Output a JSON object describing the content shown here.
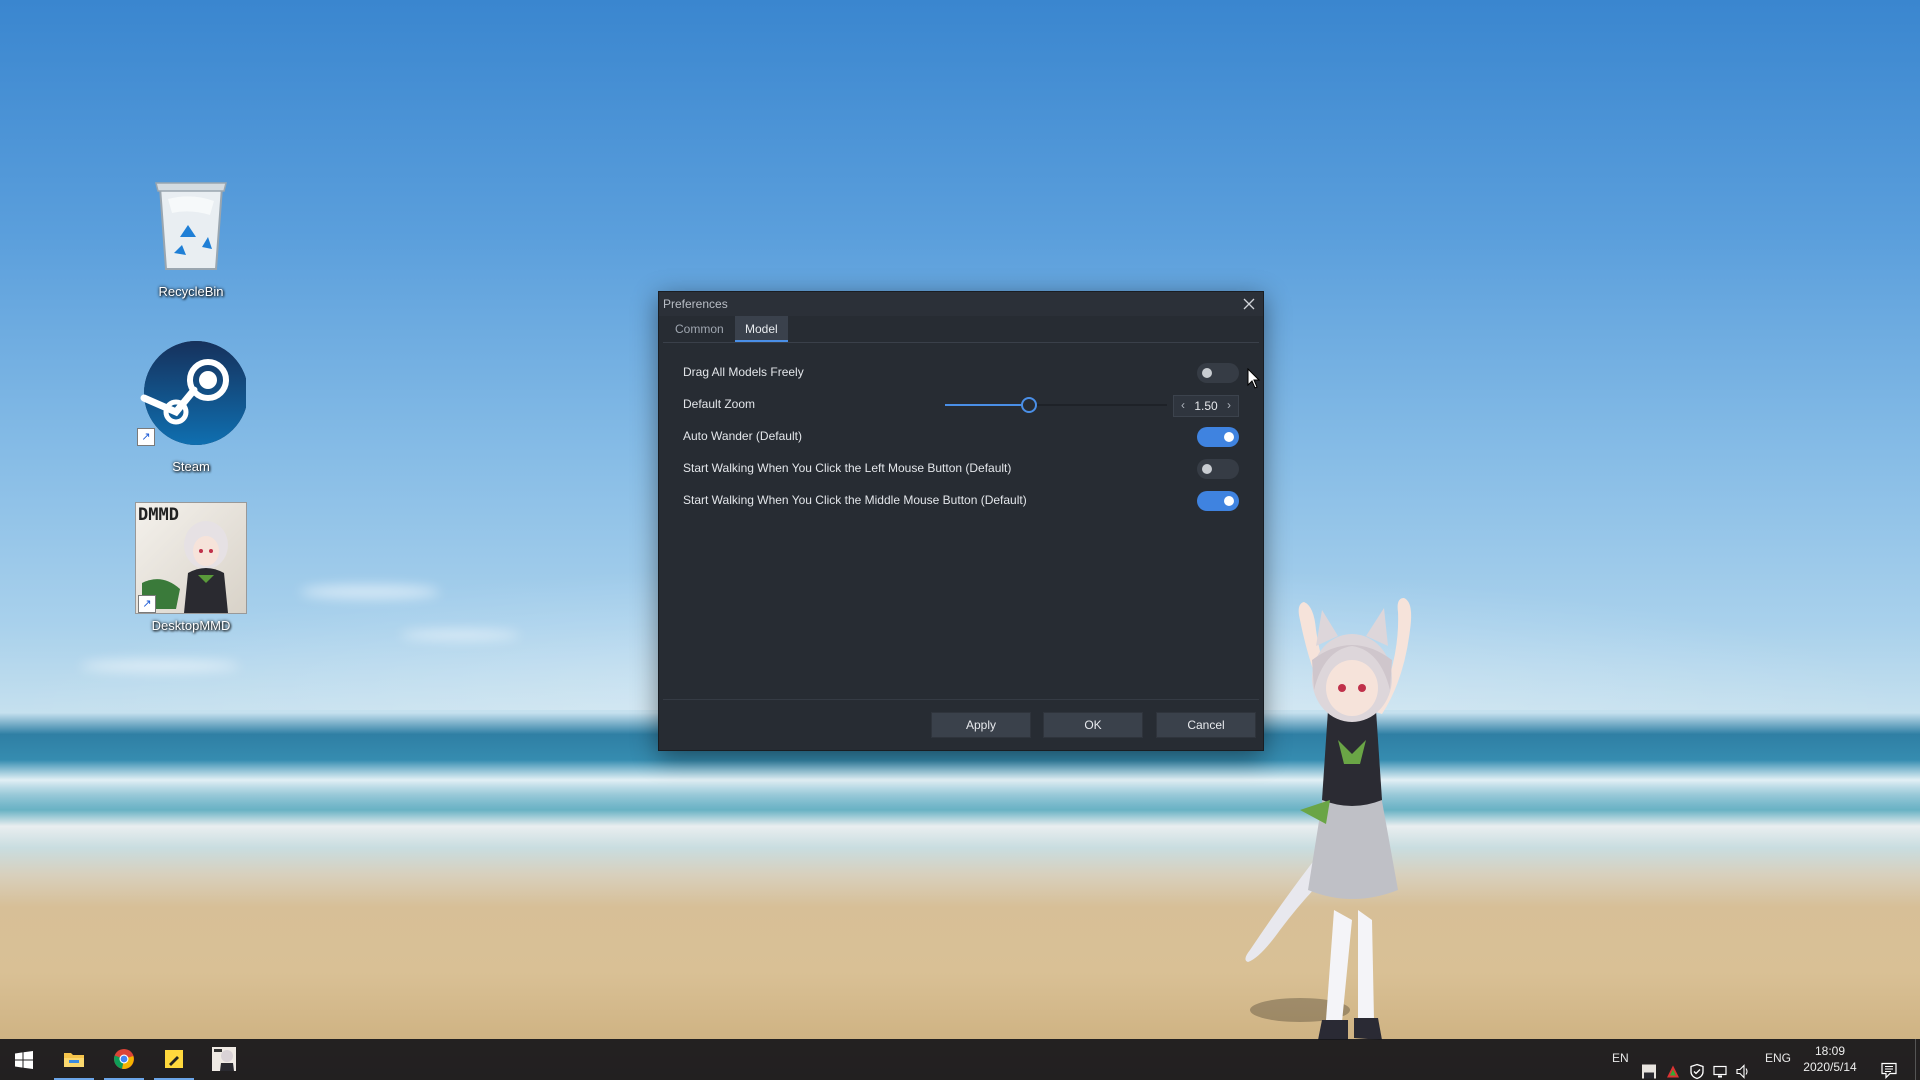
{
  "desktop": {
    "icons": [
      {
        "label": "RecycleBin"
      },
      {
        "label": "Steam"
      },
      {
        "label": "DesktopMMD",
        "thumb_text": "DMMD"
      }
    ]
  },
  "dialog": {
    "title": "Preferences",
    "tabs": [
      {
        "label": "Common",
        "active": false
      },
      {
        "label": "Model",
        "active": true
      }
    ],
    "settings": [
      {
        "label": "Drag All Models Freely",
        "type": "toggle",
        "on": false
      },
      {
        "label": "Default Zoom",
        "type": "slider",
        "value": "1.50",
        "fraction": 0.38
      },
      {
        "label": "Auto Wander (Default)",
        "type": "toggle",
        "on": true
      },
      {
        "label": "Start Walking When You Click the Left Mouse Button (Default)",
        "type": "toggle",
        "on": false
      },
      {
        "label": "Start Walking When You Click the Middle Mouse Button (Default)",
        "type": "toggle",
        "on": true
      }
    ],
    "buttons": {
      "apply": "Apply",
      "ok": "OK",
      "cancel": "Cancel"
    }
  },
  "taskbar": {
    "lang_short": "EN",
    "lang": "ENG",
    "time": "18:09",
    "date": "2020/5/14"
  },
  "colors": {
    "accent": "#4a8fe7",
    "dialog_bg": "#272c33",
    "toggle_on": "#3f83e0"
  }
}
